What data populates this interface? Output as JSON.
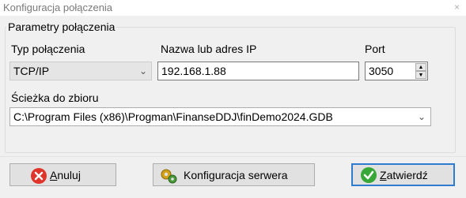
{
  "window": {
    "title": "Konfiguracja połączenia",
    "close_glyph": "×"
  },
  "group": {
    "legend": "Parametry połączenia"
  },
  "connection_type": {
    "label": "Typ połączenia",
    "value": "TCP/IP"
  },
  "host": {
    "label": "Nazwa lub adres IP",
    "value": "192.168.1.88"
  },
  "port": {
    "label": "Port",
    "value": "3050"
  },
  "database_path": {
    "label": "Ścieżka do zbioru",
    "value": "C:\\Program Files (x86)\\Progman\\FinanseDDJ\\finDemo2024.GDB"
  },
  "buttons": {
    "cancel": {
      "accel": "A",
      "rest": "nuluj",
      "icon": "cancel-x-icon"
    },
    "server_config": {
      "label": "Konfiguracja serwera",
      "icon": "gears-icon"
    },
    "confirm": {
      "accel": "Z",
      "rest": "atwierdź",
      "icon": "check-icon"
    }
  },
  "colors": {
    "cancel_icon": "#e0352b",
    "confirm_icon": "#37a737",
    "default_button_border": "#2e7bd0"
  }
}
